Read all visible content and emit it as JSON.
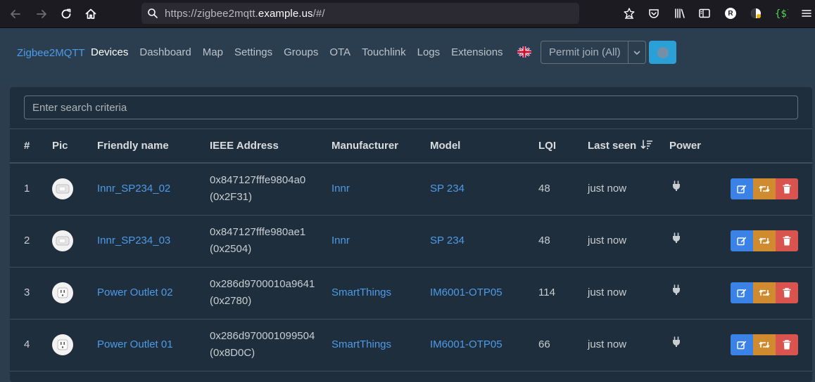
{
  "browser": {
    "url_prefix": "https://zigbee2mqtt.",
    "url_domain": "example.us",
    "url_suffix": "/#/"
  },
  "navbar": {
    "brand": "Zigbee2MQTT",
    "links": [
      {
        "label": "Devices",
        "active": true
      },
      {
        "label": "Dashboard"
      },
      {
        "label": "Map"
      },
      {
        "label": "Settings"
      },
      {
        "label": "Groups"
      },
      {
        "label": "OTA"
      },
      {
        "label": "Touchlink"
      },
      {
        "label": "Logs"
      },
      {
        "label": "Extensions"
      }
    ],
    "permit_join_label": "Permit join (All)"
  },
  "search": {
    "placeholder": "Enter search criteria"
  },
  "table": {
    "headers": [
      "#",
      "Pic",
      "Friendly name",
      "IEEE Address",
      "Manufacturer",
      "Model",
      "LQI",
      "Last seen",
      "Power"
    ],
    "rows": [
      {
        "num": "1",
        "pic": "plug-icon",
        "friendly_name": "Innr_SP234_02",
        "ieee": "0x847127fffe9804a0",
        "nwk": "(0x2F31)",
        "manufacturer": "Innr",
        "model": "SP 234",
        "lqi": "48",
        "last_seen": "just now",
        "power": "plug-icon"
      },
      {
        "num": "2",
        "pic": "plug-icon",
        "friendly_name": "Innr_SP234_03",
        "ieee": "0x847127fffe980ae1",
        "nwk": "(0x2504)",
        "manufacturer": "Innr",
        "model": "SP 234",
        "lqi": "48",
        "last_seen": "just now",
        "power": "plug-icon"
      },
      {
        "num": "3",
        "pic": "outlet-icon",
        "friendly_name": "Power Outlet 02",
        "ieee": "0x286d9700010a9641",
        "nwk": "(0x2780)",
        "manufacturer": "SmartThings",
        "model": "IM6001-OTP05",
        "lqi": "114",
        "last_seen": "just now",
        "power": "plug-icon"
      },
      {
        "num": "4",
        "pic": "outlet-icon",
        "friendly_name": "Power Outlet 01",
        "ieee": "0x286d970001099504",
        "nwk": "(0x8D0C)",
        "manufacturer": "SmartThings",
        "model": "IM6001-OTP05",
        "lqi": "66",
        "last_seen": "just now",
        "power": "plug-icon"
      }
    ]
  },
  "colors": {
    "page_bg": "#2b3e50",
    "card_bg": "#1f2e3c",
    "link": "#4c9be8",
    "edit": "#3b82e6",
    "rename": "#d08a2f",
    "delete": "#d9534f",
    "permit_button": "#2ba0d6"
  }
}
